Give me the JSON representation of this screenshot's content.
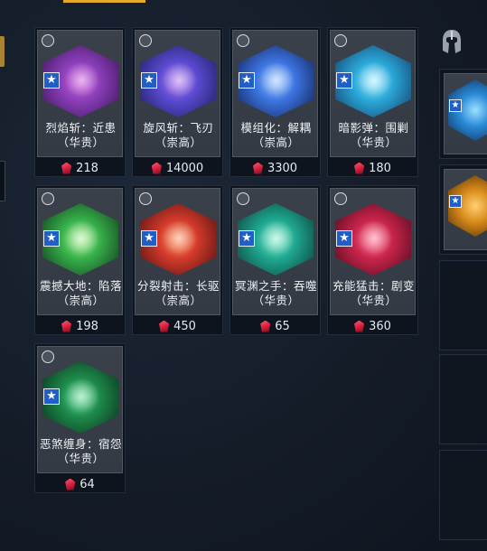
{
  "currency": {
    "icon": "red-gem-icon",
    "color": "#e0223f"
  },
  "accent_color": "#e8a82a",
  "side_panel": {
    "icon": "spartan-helmet-icon"
  },
  "cards": [
    {
      "name": "烈焰斩：近患（华贵）",
      "price": "218",
      "owned_icon": "clock-icon",
      "art": "purple-swirl",
      "colors": [
        "#8a3fb8",
        "#3a1358",
        "#d25fe0"
      ]
    },
    {
      "name": "旋风斩：飞刃（崇高）",
      "price": "14000",
      "owned_icon": "clock-icon",
      "art": "violet-blade",
      "colors": [
        "#5a4ad0",
        "#1a1c5a",
        "#b67cf0"
      ]
    },
    {
      "name": "模组化：解耦（崇高）",
      "price": "3300",
      "owned_icon": "clock-icon",
      "art": "blue-crystal",
      "colors": [
        "#3c74e0",
        "#0f1f52",
        "#9cc8ff"
      ]
    },
    {
      "name": "暗影弹：围剿（华贵）",
      "price": "180",
      "owned_icon": "clock-icon",
      "art": "cyan-orb",
      "colors": [
        "#2aa8d8",
        "#123a66",
        "#a6ecff"
      ]
    },
    {
      "name": "震撼大地：陷落（崇高）",
      "price": "198",
      "owned_icon": "clock-icon",
      "art": "green-impact",
      "colors": [
        "#36b04a",
        "#10361c",
        "#b4f49c"
      ]
    },
    {
      "name": "分裂射击：长驱（崇高）",
      "price": "450",
      "owned_icon": "clock-icon",
      "art": "red-arrows",
      "colors": [
        "#d23a2a",
        "#4a0f10",
        "#ff9a66"
      ]
    },
    {
      "name": "冥渊之手：吞噬（华贵）",
      "price": "65",
      "owned_icon": "clock-icon",
      "art": "teal-vortex",
      "colors": [
        "#1ea890",
        "#0c3a36",
        "#8ff0d0"
      ]
    },
    {
      "name": "充能猛击：剧变（华贵）",
      "price": "360",
      "owned_icon": "clock-icon",
      "art": "crimson-burst",
      "colors": [
        "#c8244a",
        "#4a0a1c",
        "#ff7a9a"
      ]
    },
    {
      "name": "恶煞缠身：宿怨（华贵）",
      "price": "64",
      "owned_icon": "clock-icon",
      "art": "emerald-sigil",
      "colors": [
        "#1d8a4a",
        "#0a2a1c",
        "#6ce0a0"
      ]
    }
  ],
  "side_cards": [
    {
      "art": "blue-orbs",
      "colors": [
        "#2a8ad8",
        "#0c2a52",
        "#9ce0ff"
      ]
    },
    {
      "art": "golden-flame",
      "colors": [
        "#d88a1a",
        "#4a2a06",
        "#ffd070"
      ]
    }
  ]
}
